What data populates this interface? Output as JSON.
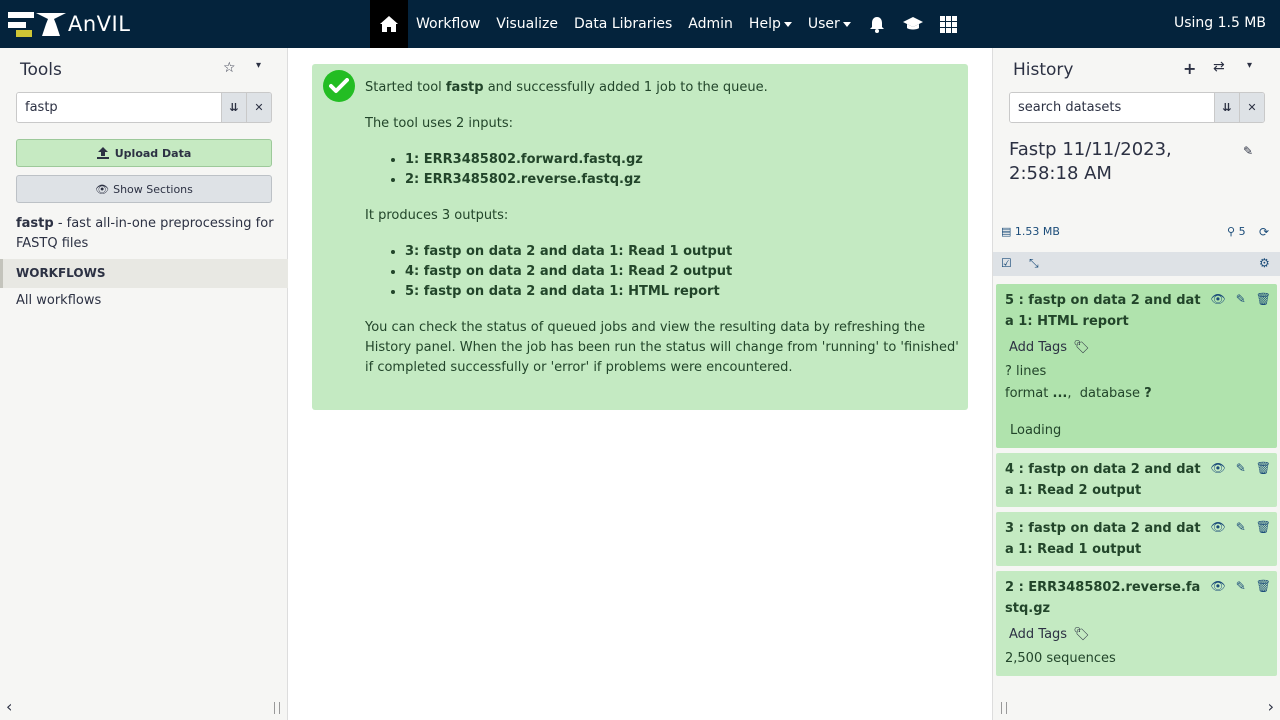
{
  "brand": {
    "name": "AnVIL"
  },
  "nav": {
    "items": [
      "Workflow",
      "Visualize",
      "Data Libraries",
      "Admin",
      "Help",
      "User"
    ],
    "quota": "Using 1.5 MB"
  },
  "tools": {
    "title": "Tools",
    "search_value": "fastp",
    "upload_label": "Upload Data",
    "sections_label": "Show Sections",
    "result_name": "fastp",
    "result_desc": " - fast all-in-one preprocessing for FASTQ files",
    "workflows_header": "WORKFLOWS",
    "all_workflows": "All workflows"
  },
  "message": {
    "line1_pre": "Started tool ",
    "line1_tool": "fastp",
    "line1_post": " and successfully added 1 job to the queue.",
    "inputs_intro": "The tool uses 2 inputs:",
    "inputs": [
      "1: ERR3485802.forward.fastq.gz",
      "2: ERR3485802.reverse.fastq.gz"
    ],
    "outputs_intro": "It produces 3 outputs:",
    "outputs": [
      "3: fastp on data 2 and data 1: Read 1 output",
      "4: fastp on data 2 and data 1: Read 2 output",
      "5: fastp on data 2 and data 1: HTML report"
    ],
    "footer": "You can check the status of queued jobs and view the resulting data by refreshing the History panel. When the job has been run the status will change from 'running' to 'finished' if completed successfully or 'error' if problems were encountered."
  },
  "history": {
    "title": "History",
    "search_placeholder": "search datasets",
    "name": "Fastp 11/11/2023, 2:58:18 AM",
    "size": "1.53 MB",
    "count": "5",
    "items": [
      {
        "title": "5 : fastp on data 2 and data 1: HTML report",
        "tags_label": "Add Tags",
        "lines": "? lines",
        "format_label": "format",
        "format_value": "...",
        "database_label": "database",
        "database_value": "?",
        "loading": "Loading"
      },
      {
        "title": "4 : fastp on data 2 and data 1: Read 2 output"
      },
      {
        "title": "3 : fastp on data 2 and data 1: Read 1 output"
      },
      {
        "title": "2 : ERR3485802.reverse.fastq.gz",
        "tags_label": "Add Tags",
        "sequences": "2,500 sequences"
      }
    ]
  },
  "colors": {
    "masthead": "#04233c",
    "success_bg": "#c4eac2",
    "check_green": "#23bd23",
    "link_blue": "#1b4c79"
  }
}
